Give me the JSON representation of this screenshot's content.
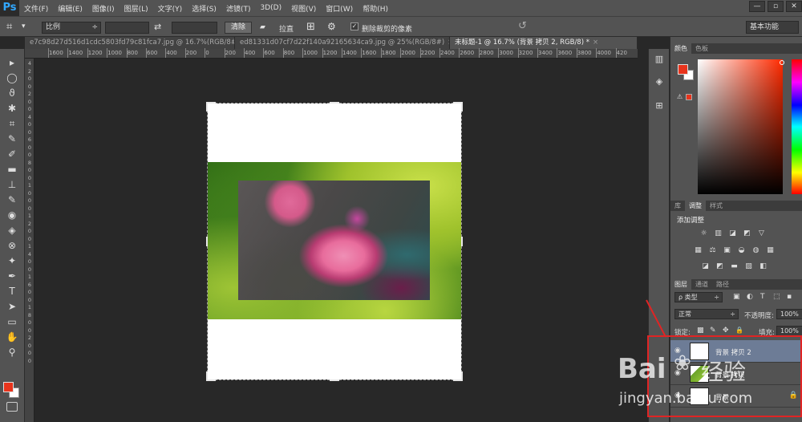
{
  "app": {
    "logo": "Ps"
  },
  "menu": [
    "文件(F)",
    "编辑(E)",
    "图像(I)",
    "图层(L)",
    "文字(Y)",
    "选择(S)",
    "滤镜(T)",
    "3D(D)",
    "视图(V)",
    "窗口(W)",
    "帮助(H)"
  ],
  "window_controls": [
    "—",
    "▫",
    "✕"
  ],
  "options_bar": {
    "ratio_select": "比例",
    "ratio_select_arrow": "÷",
    "swap_icon": "⇄",
    "clear_button": "清除",
    "straighten_label": "拉直",
    "delete_cropped_label": "删除裁剪的像素",
    "delete_cropped_checked": true,
    "checkmark": "✓",
    "reset_icon": "↺",
    "workspace": "基本功能"
  },
  "document_tabs": [
    {
      "label": "e7c98d27d516d1cdc5803fd79c81fca7.jpg @ 16.7%(RGB/8#)",
      "active": false
    },
    {
      "label": "ed81331d07cf7d22f140a92165634ca9.jpg @ 25%(RGB/8#)",
      "active": false
    },
    {
      "label": "未标题-1 @ 16.7% (背景 拷贝 2, RGB/8) *",
      "active": true
    }
  ],
  "tab_close": "×",
  "ruler_top": [
    "1600",
    "1400",
    "1200",
    "1000",
    "800",
    "600",
    "400",
    "200",
    "0",
    "200",
    "400",
    "600",
    "800",
    "1000",
    "1200",
    "1400",
    "1600",
    "1800",
    "2000",
    "2200",
    "2400",
    "2600",
    "2800",
    "3000",
    "3200",
    "3400",
    "3600",
    "3800",
    "4000",
    "420"
  ],
  "ruler_left": [
    "4",
    "2",
    "0",
    "0",
    "2",
    "0",
    "0",
    "4",
    "0",
    "0",
    "6",
    "0",
    "0",
    "8",
    "0",
    "0",
    "1",
    "0",
    "0",
    "0",
    "1",
    "2",
    "0",
    "0",
    "1",
    "4",
    "0",
    "0",
    "1",
    "6",
    "0",
    "0",
    "1",
    "8",
    "0",
    "0",
    "2",
    "0",
    "0",
    "0"
  ],
  "tools": [
    "▸",
    "◯",
    "ϑ",
    "✱",
    "⌗",
    "✎",
    "✐",
    "▬",
    "⊥",
    "✎",
    "◉",
    "◈",
    "⊗",
    "✦",
    "✒",
    "T",
    "➤",
    "▭",
    "✋",
    "⚲"
  ],
  "color_panel": {
    "tabs": [
      "颜色",
      "色板"
    ],
    "foreground": "#e8341c",
    "background": "#ffffff",
    "warning_icon": "⚠"
  },
  "adjust_panel": {
    "tabs": [
      "库",
      "调整",
      "样式"
    ],
    "title": "添加调整",
    "icons_row1": [
      "☼",
      "▥",
      "◪",
      "◩",
      "▽"
    ],
    "icons_row2": [
      "▦",
      "⚖",
      "▣",
      "◒",
      "◍",
      "▦"
    ],
    "icons_row3": [
      "◪",
      "◩",
      "▬",
      "▨",
      "◧"
    ]
  },
  "layers_panel": {
    "tabs": [
      "图层",
      "通道",
      "路径"
    ],
    "filter": "ρ 类型",
    "filter_arrow": "÷",
    "filter_icons": [
      "▣",
      "◐",
      "T",
      "⬚",
      "▪"
    ],
    "blend_mode": "正常",
    "blend_arrow": "÷",
    "opacity_label": "不透明度:",
    "opacity_value": "100%",
    "lock_label": "锁定:",
    "lock_icons": [
      "▩",
      "✎",
      "✥",
      "🔒"
    ],
    "fill_label": "填充:",
    "fill_value": "100%",
    "layers": [
      {
        "name": "背景 拷贝 2",
        "active": true,
        "locked": false
      },
      {
        "name": "背景 拷贝",
        "active": false,
        "locked": false
      },
      {
        "name": "背景",
        "active": false,
        "locked": true
      }
    ],
    "eye_icon": "◉",
    "lock_icon": "🔒"
  },
  "watermark": {
    "brand": "Bai",
    "brand_cn": "经验",
    "url": "jingyan.baidu.com"
  },
  "panel_strip_icons": [
    "▥",
    "◈",
    "⊞"
  ],
  "colors": {
    "annotation_red": "#e02424",
    "active_layer": "#6d7c96"
  }
}
